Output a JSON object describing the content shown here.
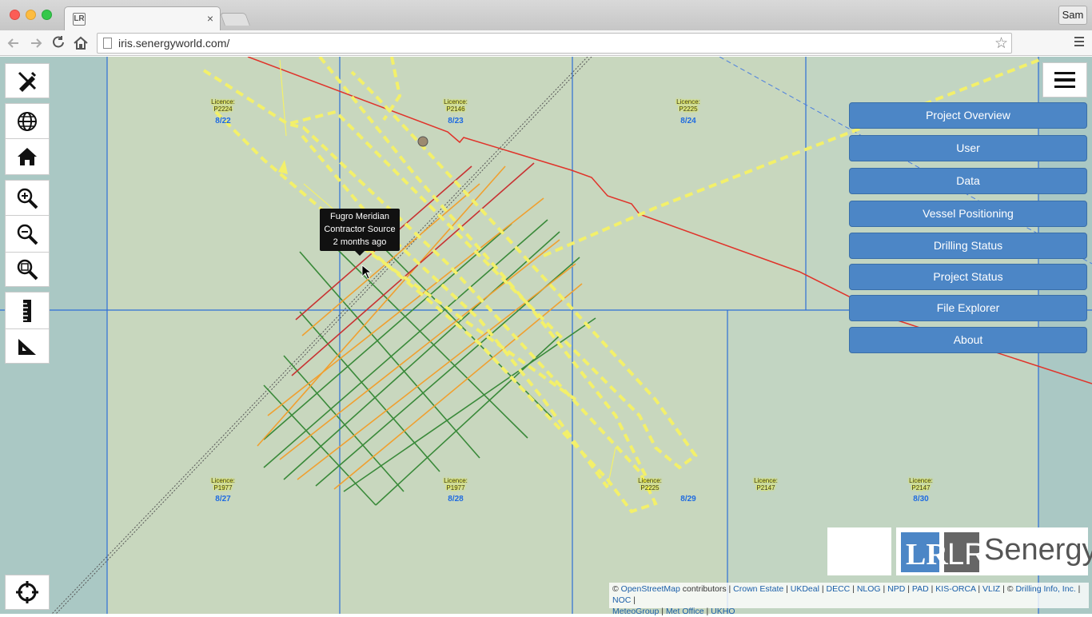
{
  "browser": {
    "tab_favicon": "LR",
    "tab_close": "×",
    "user_button": "Sam",
    "url": "iris.senergyworld.com/",
    "back_icon": "arrow-left",
    "forward_icon": "arrow-right",
    "reload_icon": "reload",
    "home_icon": "home",
    "star_icon": "star",
    "menu_icon": "hamburger"
  },
  "map": {
    "licences": [
      {
        "licence": "Licence:\nP2224",
        "block": "8/22"
      },
      {
        "licence": "Licence:\nP2146",
        "block": "8/23"
      },
      {
        "licence": "Licence:\nP2225",
        "block": "8/24"
      },
      {
        "licence": "Licence:\nP1977",
        "block": "8/27"
      },
      {
        "licence": "Licence:\nP1977",
        "block": "8/28"
      },
      {
        "licence": "Licence:\nP2225",
        "block": "8/29"
      },
      {
        "licence": "Licence:\nP2147",
        "block": ""
      },
      {
        "licence": "Licence:\nP2147",
        "block": "8/30"
      }
    ],
    "tooltip": {
      "line1": "Fugro Meridian",
      "line2": "Contractor Source",
      "line3": "2 months ago"
    },
    "colors": {
      "water": "#aac8c4",
      "land_block": "#c6d6bd",
      "grid": "#2d6fd6",
      "boundary": "#e0332a",
      "track": "#f3f06a",
      "green_line": "#3a8a3a",
      "orange_line": "#f0a030",
      "red_line": "#c83232"
    }
  },
  "tools": [
    {
      "name": "draw-tool",
      "icon": "pencil-ruler-icon"
    },
    {
      "name": "globe-tool",
      "icon": "globe-icon"
    },
    {
      "name": "home-tool",
      "icon": "home-icon"
    },
    {
      "name": "zoom-in-tool",
      "icon": "zoom-in-icon"
    },
    {
      "name": "zoom-out-tool",
      "icon": "zoom-out-icon"
    },
    {
      "name": "zoom-extent-tool",
      "icon": "zoom-extent-icon"
    },
    {
      "name": "ruler-tool",
      "icon": "ruler-icon"
    },
    {
      "name": "set-square-tool",
      "icon": "set-square-icon"
    },
    {
      "name": "locate-tool",
      "icon": "crosshair-icon"
    }
  ],
  "menu": {
    "items": [
      "Project Overview",
      "User",
      "Data",
      "Vessel Positioning",
      "Drilling Status",
      "Project Status",
      "File Explorer",
      "About"
    ]
  },
  "logo": {
    "mark": "LR",
    "text": "Senergy"
  },
  "attribution": {
    "copy1": "©",
    "osm": "OpenStreetMap",
    "contributors": "contributors |",
    "crown": "Crown Estate",
    "ukdeal": "UKDeal",
    "decc": "DECC",
    "nlog": "NLOG",
    "npd": "NPD",
    "pad": "PAD",
    "kis": "KIS-ORCA",
    "vliz": "VLIZ",
    "copy2": "©",
    "drilling": "Drilling Info, Inc.",
    "noc": "NOC",
    "meteo": "MeteoGroup",
    "metoffice": "Met Office",
    "ukho": "UKHO"
  }
}
